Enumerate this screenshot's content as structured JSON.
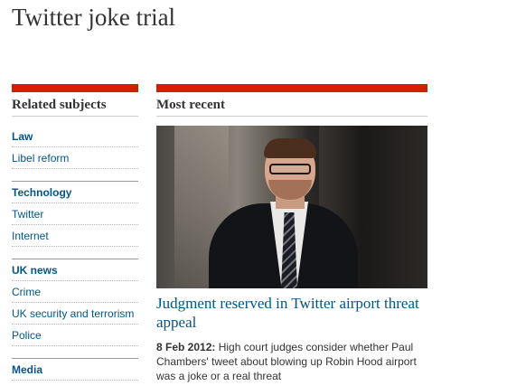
{
  "page": {
    "title": "Twitter joke trial"
  },
  "related": {
    "heading": "Related subjects",
    "groups": [
      {
        "name": "Law",
        "links": [
          "Libel reform"
        ]
      },
      {
        "name": "Technology",
        "links": [
          "Twitter",
          "Internet"
        ]
      },
      {
        "name": "UK news",
        "links": [
          "Crime",
          "UK security and terrorism",
          "Police"
        ]
      },
      {
        "name": "Media",
        "links": []
      }
    ]
  },
  "recent": {
    "heading": "Most recent",
    "article": {
      "image_alt": "photo-of-man-in-suit",
      "headline": "Judgment reserved in Twitter airport threat appeal",
      "date": "8 Feb 2012:",
      "standfirst": "High court judges consider whether Paul Chambers' tweet about blowing up Robin Hood airport was a joke or a real threat"
    }
  },
  "colors": {
    "accent_red": "#d41e00",
    "link_blue": "#005689",
    "text": "#333333"
  }
}
